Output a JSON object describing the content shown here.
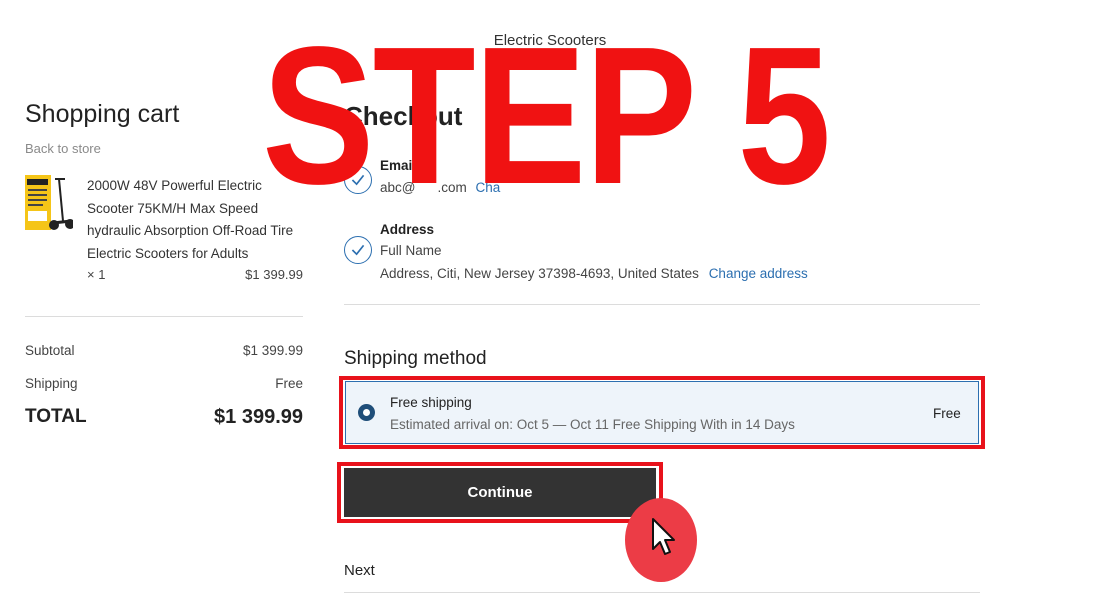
{
  "header": {
    "store_name": "Electric Scooters"
  },
  "cart": {
    "title": "Shopping cart",
    "back_link": "Back to store",
    "item": {
      "name": "2000W 48V Powerful Electric Scooter 75KM/H Max Speed hydraulic Absorption Off-Road Tire Electric Scooters for Adults",
      "qty": "× 1",
      "price": "$1 399.99"
    },
    "subtotal_label": "Subtotal",
    "subtotal_value": "$1 399.99",
    "shipping_label": "Shipping",
    "shipping_value": "Free",
    "total_label": "TOTAL",
    "total_value": "$1 399.99"
  },
  "checkout": {
    "title": "Checkout",
    "email": {
      "label": "Email",
      "value": "abc@",
      "value_tail": ".com",
      "change_link": "Cha"
    },
    "address": {
      "label": "Address",
      "name": "Full Name",
      "line": "Address, Citi, New Jersey 37398-4693, United States",
      "change_link": "Change address"
    },
    "shipping_section_title": "Shipping method",
    "shipping_option": {
      "name": "Free shipping",
      "eta": "Estimated arrival on: Oct 5 — Oct 11 Free Shipping With in 14 Days",
      "price": "Free"
    },
    "continue_label": "Continue",
    "next_label": "Next"
  },
  "overlay": {
    "step_text": "STEP 5"
  },
  "colors": {
    "overlay_red": "#f01212",
    "link_blue": "#2c6fb0",
    "button_dark": "#333333",
    "selected_bg": "#eef4fa"
  },
  "icons": {
    "check": "check-circle-icon",
    "cursor": "mouse-pointer-icon"
  }
}
